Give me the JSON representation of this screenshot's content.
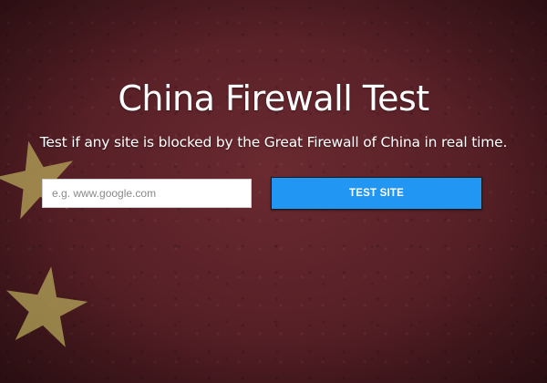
{
  "hero": {
    "title": "China Firewall Test",
    "subtitle": "Test if any site is blocked by the Great Firewall of China in real time."
  },
  "search": {
    "placeholder": "e.g. www.google.com",
    "value": ""
  },
  "actions": {
    "test_label": "TEST SITE"
  },
  "background": {
    "theme": "chinese-flag",
    "colors": {
      "base": "#5a2128",
      "star": "#c9c064",
      "button": "#2196f3"
    },
    "icons": [
      "star-icon",
      "star-icon"
    ]
  }
}
